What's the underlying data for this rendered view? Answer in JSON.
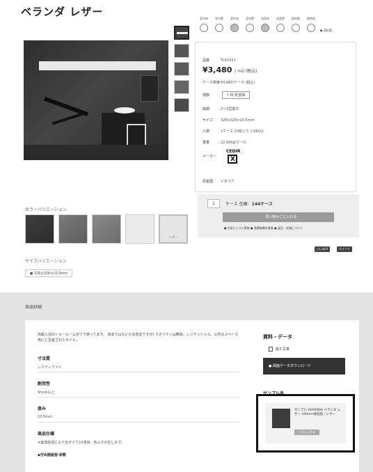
{
  "page": {
    "title": "ベランダ レザー"
  },
  "attribute_icons": {
    "labels": [
      "室内床",
      "室内壁",
      "室外床",
      "室外壁",
      "浴室床",
      "浴室壁",
      "厨房壁",
      "厨房床"
    ],
    "legend": "● 適応箇"
  },
  "spec": {
    "code_label": "品番",
    "code": "TL61331",
    "price": "¥3,480",
    "price_unit": "/ m2 (税込)",
    "case_price_label": "ケース単価",
    "case_price": "¥3,880/ケース (税込)",
    "pattern_label": "柄数",
    "pattern_button": "1 柄 配置図",
    "delivery_label": "納期",
    "delivery": "2～3営業日",
    "size_label": "サイズ",
    "size": "326×326×10.5mm",
    "pack_label": "入数",
    "pack": "1ケース 10枚入り 1.06m2",
    "weight_label": "重量",
    "weight": "22.00kg/ケース",
    "maker_label": "メーカー",
    "maker_brand": "CEDIR",
    "origin_label": "原産国",
    "origin": "イタリア"
  },
  "cart": {
    "qty": "1",
    "note_prefix": "ケース  在庫：",
    "stock": "144ケース",
    "add_button": "買い物かごに入れる",
    "links": "● お気に入りに登録  ● 見積依頼を登録  ● 返品・交換について"
  },
  "sns": {
    "like": "いいね!0",
    "share": "ツイート"
  },
  "color_variation": {
    "label": "カラーバリエーション",
    "selected_caption": "レザー"
  },
  "size_variation": {
    "label": "サイズバリエーション",
    "option": "● 326×326×10.5mm"
  },
  "detail": {
    "section_title": "商品詳細",
    "description": "高級入浴のショールーム全てで使ってます。 旧本ではないかお他支ですが) クオリティは費高。レジデンシャル、公共のスペース用にと生産されたタイル。",
    "usage_head": "寸法質",
    "usage_val": "レクティファイ",
    "strength_head": "耐用性",
    "strength_val": "Shore以上",
    "thickness_head": "厚み",
    "thickness_val": "10.5mm",
    "spec_head": "商品仕様",
    "spec_val": "※面違結成により全タイで10適良、色ムラが生じます。",
    "trailing": "◆付出施設容-状態"
  },
  "resources": {
    "title": "資料・データ",
    "photo": "施工写真",
    "download": "● 図面データダウンロード"
  },
  "sample": {
    "title": "サンプル品",
    "name": "サンプル VERANDA ベランダ レザー 100mm角程度 / レザー",
    "button": "カゴに入れる"
  }
}
